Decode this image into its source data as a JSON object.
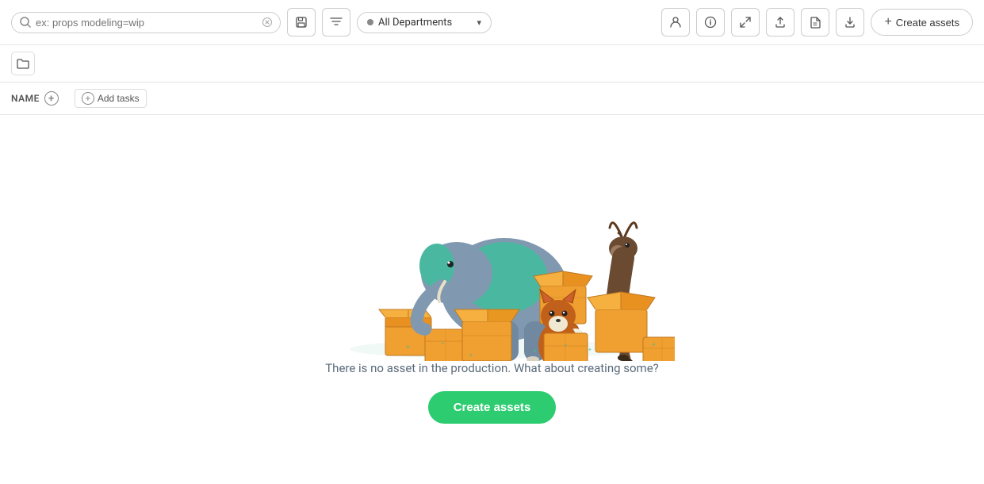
{
  "toolbar": {
    "search_placeholder": "ex: props modeling=wip",
    "search_value": "",
    "save_search_label": "Save search",
    "filter_label": "Filter",
    "department_label": "All Departments",
    "create_assets_label": "Create assets",
    "icon_person": "👤",
    "icon_info": "ℹ",
    "icon_expand": "⤢",
    "icon_upload": "⬆",
    "icon_file": "📄",
    "icon_download": "⬇"
  },
  "second_row": {
    "folder_icon": "📁"
  },
  "table_header": {
    "name_label": "NAME",
    "add_tasks_label": "Add tasks"
  },
  "empty_state": {
    "message": "There is no asset in the production. What about creating some?",
    "button_label": "Create assets"
  }
}
